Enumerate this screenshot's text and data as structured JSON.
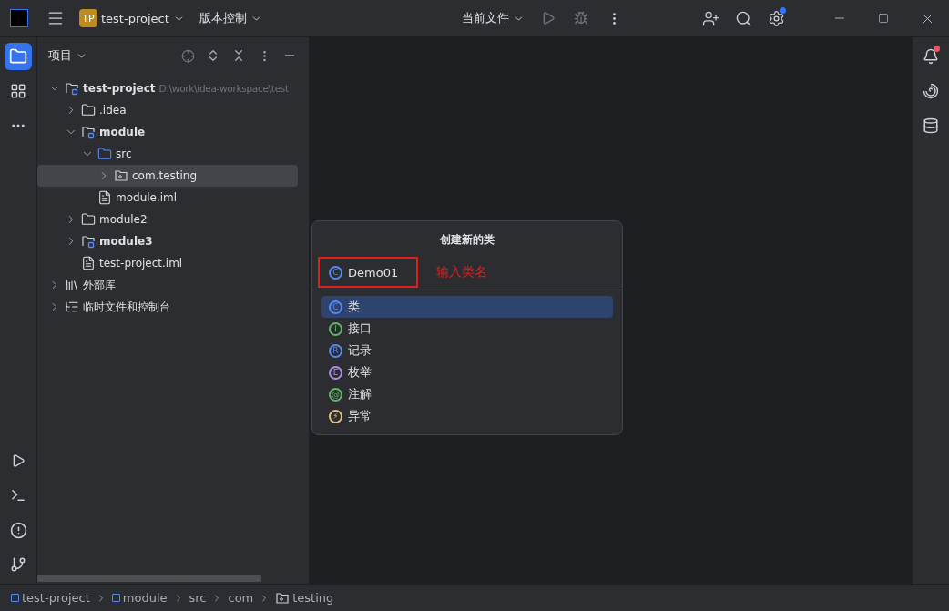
{
  "titlebar": {
    "project_badge": "TP",
    "project": "test-project",
    "vcs": "版本控制",
    "run_config": "当前文件",
    "settings_notification": true
  },
  "project_panel": {
    "title": "项目",
    "tree": [
      {
        "label": "test-project",
        "path": "D:\\work\\idea-workspace\\test",
        "kind": "module",
        "bold": true,
        "expanded": true,
        "selected": false,
        "children": [
          {
            "label": ".idea",
            "kind": "folder",
            "bold": false,
            "expanded": false,
            "selected": false
          },
          {
            "label": "module",
            "kind": "module",
            "bold": true,
            "expanded": true,
            "selected": false,
            "children": [
              {
                "label": "src",
                "kind": "source",
                "bold": false,
                "expanded": true,
                "selected": false,
                "children": [
                  {
                    "label": "com.testing",
                    "kind": "package",
                    "bold": false,
                    "expanded": false,
                    "selected": true
                  }
                ]
              },
              {
                "label": "module.iml",
                "kind": "file",
                "bold": false,
                "selected": false
              }
            ]
          },
          {
            "label": "module2",
            "kind": "folder",
            "bold": false,
            "expanded": false,
            "selected": false
          },
          {
            "label": "module3",
            "kind": "module",
            "bold": true,
            "expanded": false,
            "selected": false
          },
          {
            "label": "test-project.iml",
            "kind": "file",
            "bold": false,
            "selected": false
          }
        ]
      },
      {
        "label": "外部库",
        "kind": "library",
        "bold": false,
        "expanded": false,
        "selected": false
      },
      {
        "label": "临时文件和控制台",
        "kind": "scratch",
        "bold": false,
        "expanded": false,
        "selected": false
      }
    ]
  },
  "dialog": {
    "title": "创建新的类",
    "input": {
      "letter": "C",
      "color": "#548af7",
      "value": "Demo01"
    },
    "annotation": "输入类名",
    "options": [
      {
        "letter": "C",
        "label": "类",
        "color": "#548af7",
        "selected": true
      },
      {
        "letter": "I",
        "label": "接口",
        "color": "#5fb865",
        "selected": false
      },
      {
        "letter": "R",
        "label": "记录",
        "color": "#548af7",
        "selected": false
      },
      {
        "letter": "E",
        "label": "枚举",
        "color": "#b189f5",
        "selected": false
      },
      {
        "letter": "@",
        "label": "注解",
        "color": "#5fb865",
        "selected": false
      },
      {
        "letter": "⚡",
        "label": "异常",
        "color": "#e5c07b",
        "selected": false
      }
    ]
  },
  "notifications": {
    "unread": true
  },
  "breadcrumbs": [
    {
      "label": "test-project",
      "kind": "module"
    },
    {
      "label": "module",
      "kind": "module"
    },
    {
      "label": "src",
      "kind": "plain"
    },
    {
      "label": "com",
      "kind": "plain"
    },
    {
      "label": "testing",
      "kind": "package"
    }
  ]
}
